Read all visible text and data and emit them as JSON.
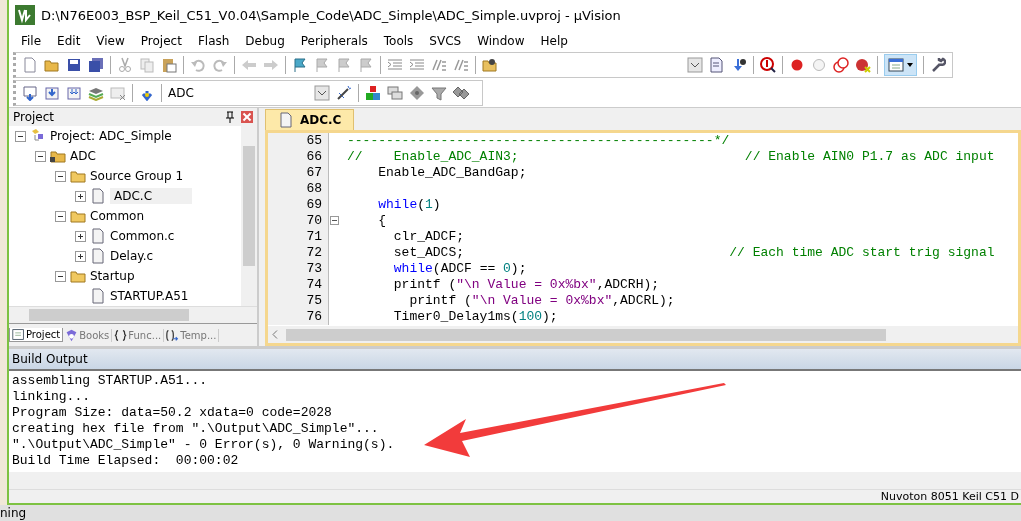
{
  "window": {
    "title": "D:\\N76E003_BSP_Keil_C51_V0.04\\Sample_Code\\ADC_Simple\\ADC_Simple.uvproj - µVision"
  },
  "menu": [
    "File",
    "Edit",
    "View",
    "Project",
    "Flash",
    "Debug",
    "Peripherals",
    "Tools",
    "SVCS",
    "Window",
    "Help"
  ],
  "build_toolbar": {
    "target": "ADC"
  },
  "project_panel": {
    "title": "Project",
    "tree": [
      {
        "label": "Project: ADC_Simple",
        "kind": "project",
        "expanded": true,
        "selected": false,
        "children": [
          {
            "label": "ADC",
            "kind": "target",
            "expanded": true,
            "selected": false,
            "children": [
              {
                "label": "Source Group 1",
                "kind": "group",
                "expanded": true,
                "selected": false,
                "children": [
                  {
                    "label": "ADC.C",
                    "kind": "file",
                    "expanded": false,
                    "selected": true
                  }
                ]
              },
              {
                "label": "Common",
                "kind": "group",
                "expanded": true,
                "selected": false,
                "children": [
                  {
                    "label": "Common.c",
                    "kind": "file",
                    "expanded": false,
                    "selected": false
                  },
                  {
                    "label": "Delay.c",
                    "kind": "file",
                    "expanded": false,
                    "selected": false
                  }
                ]
              },
              {
                "label": "Startup",
                "kind": "group",
                "expanded": true,
                "selected": false,
                "children": [
                  {
                    "label": "STARTUP.A51",
                    "kind": "file",
                    "selected": false
                  }
                ]
              }
            ]
          }
        ]
      }
    ],
    "tabs": [
      {
        "label": "Project",
        "selected": true
      },
      {
        "label": "Books",
        "selected": false
      },
      {
        "label": "Func...",
        "selected": false
      },
      {
        "label": "Temp...",
        "selected": false
      }
    ]
  },
  "editor": {
    "tabs": [
      {
        "label": "ADC.C",
        "selected": true
      }
    ],
    "lines": [
      {
        "number": "65",
        "segments": [
          {
            "kind": "comment",
            "text": "-----------------------------------------------*/"
          }
        ]
      },
      {
        "number": "66",
        "segments": [
          {
            "kind": "comment",
            "text": "//    Enable_ADC_AIN3;                             // Enable AIN0 P1.7 as ADC input"
          }
        ]
      },
      {
        "number": "67",
        "segments": [
          {
            "kind": "plain",
            "text": "    Enable_ADC_BandGap;"
          }
        ]
      },
      {
        "number": "68"
      },
      {
        "number": "69",
        "segments": [
          {
            "kind": "keyword",
            "text": "    while"
          },
          {
            "kind": "plain",
            "text": "("
          },
          {
            "kind": "number",
            "text": "1"
          },
          {
            "kind": "plain",
            "text": ")"
          }
        ]
      },
      {
        "number": "70",
        "fold": true,
        "segments": [
          {
            "kind": "plain",
            "text": "    {"
          }
        ]
      },
      {
        "number": "71",
        "segments": [
          {
            "kind": "plain",
            "text": "      clr_ADCF;"
          }
        ]
      },
      {
        "number": "72",
        "segments": [
          {
            "kind": "plain",
            "text": "      set_ADCS;                                  "
          },
          {
            "kind": "comment",
            "text": "// Each time ADC start trig signal"
          }
        ]
      },
      {
        "number": "73",
        "segments": [
          {
            "kind": "keyword",
            "text": "      while"
          },
          {
            "kind": "plain",
            "text": "(ADCF == "
          },
          {
            "kind": "number",
            "text": "0"
          },
          {
            "kind": "plain",
            "text": ");"
          }
        ]
      },
      {
        "number": "74",
        "segments": [
          {
            "kind": "plain",
            "text": "      printf ("
          },
          {
            "kind": "string",
            "text": "\"\\n Value = 0x%bx\""
          },
          {
            "kind": "plain",
            "text": ",ADCRH);"
          }
        ]
      },
      {
        "number": "75",
        "segments": [
          {
            "kind": "plain",
            "text": "        printf ("
          },
          {
            "kind": "string",
            "text": "\"\\n Value = 0x%bx\""
          },
          {
            "kind": "plain",
            "text": ",ADCRL);"
          }
        ]
      },
      {
        "number": "76",
        "segments": [
          {
            "kind": "plain",
            "text": "      Timer0_Delay1ms("
          },
          {
            "kind": "number",
            "text": "100"
          },
          {
            "kind": "plain",
            "text": ");"
          }
        ]
      }
    ]
  },
  "build_output": {
    "title": "Build Output",
    "lines": [
      "assembling STARTUP.A51...",
      "linking...",
      "Program Size: data=50.2 xdata=0 code=2028",
      "creating hex file from \".\\Output\\ADC_Simple\"...",
      "\".\\Output\\ADC_Simple\" - 0 Error(s), 0 Warning(s).",
      "Build Time Elapsed:  00:00:02"
    ]
  },
  "status_bar": {
    "text": "Nuvoton 8051 Keil C51 D"
  },
  "background_text": "ning"
}
